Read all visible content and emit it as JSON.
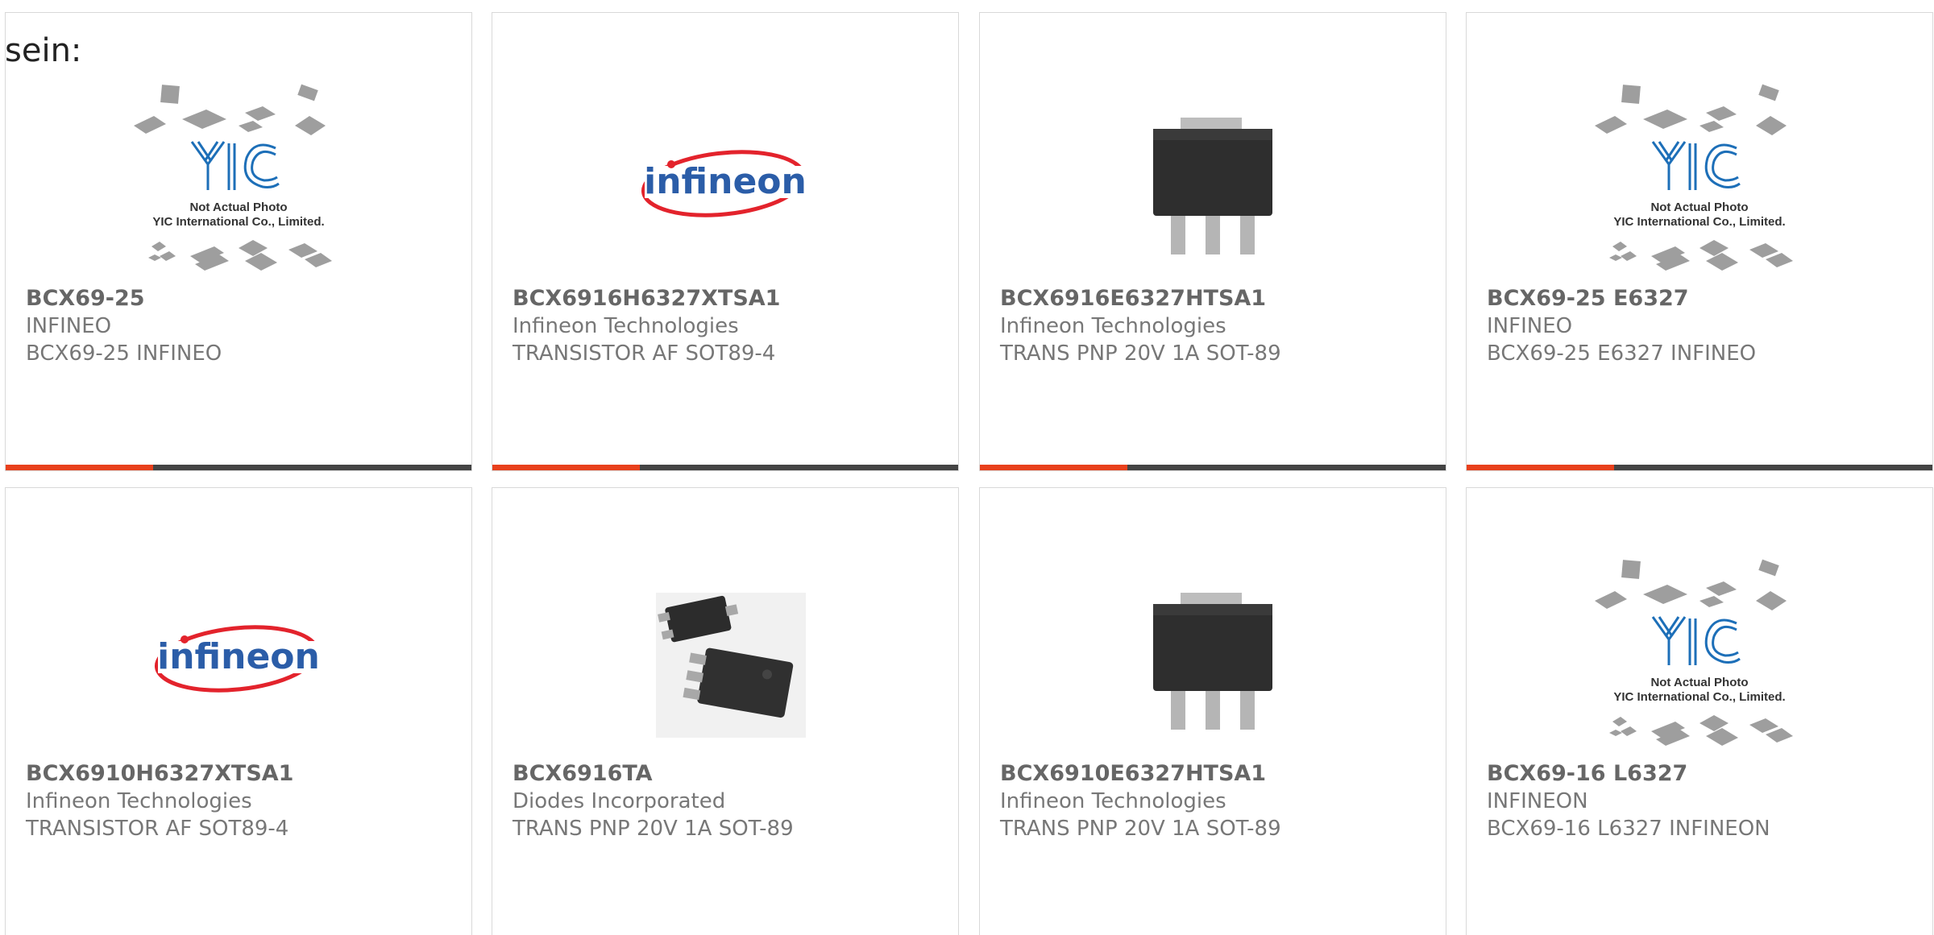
{
  "heading": "sein:",
  "colors": {
    "accent": "#e8401c",
    "bar": "#444444",
    "infineon_red": "#e3232c",
    "infineon_blue": "#2b5da8",
    "yic_blue": "#1d6fb8"
  },
  "placeholder": {
    "line1": "Not Actual Photo",
    "line2": "YIC International Co., Limited."
  },
  "products": [
    {
      "part": "BCX69-25",
      "manufacturer": "INFINEO",
      "description": "BCX69-25 INFINEO",
      "image": "yic-placeholder",
      "has_bar": true
    },
    {
      "part": "BCX6916H6327XTSA1",
      "manufacturer": "Infineon Technologies",
      "description": "TRANSISTOR AF SOT89-4",
      "image": "infineon-logo",
      "has_bar": true
    },
    {
      "part": "BCX6916E6327HTSA1",
      "manufacturer": "Infineon Technologies",
      "description": "TRANS PNP 20V 1A SOT-89",
      "image": "sot89-package",
      "has_bar": true
    },
    {
      "part": "BCX69-25 E6327",
      "manufacturer": "INFINEO",
      "description": "BCX69-25 E6327 INFINEO",
      "image": "yic-placeholder",
      "has_bar": true
    },
    {
      "part": "BCX6910H6327XTSA1",
      "manufacturer": "Infineon Technologies",
      "description": "TRANSISTOR AF SOT89-4",
      "image": "infineon-logo",
      "has_bar": false
    },
    {
      "part": "BCX6916TA",
      "manufacturer": "Diodes Incorporated",
      "description": "TRANS PNP 20V 1A SOT-89",
      "image": "sot89-diodes-package",
      "has_bar": false
    },
    {
      "part": "BCX6910E6327HTSA1",
      "manufacturer": "Infineon Technologies",
      "description": "TRANS PNP 20V 1A SOT-89",
      "image": "sot89-package",
      "has_bar": false
    },
    {
      "part": "BCX69-16 L6327",
      "manufacturer": "INFINEON",
      "description": "BCX69-16 L6327 INFINEON",
      "image": "yic-placeholder",
      "has_bar": false
    }
  ]
}
